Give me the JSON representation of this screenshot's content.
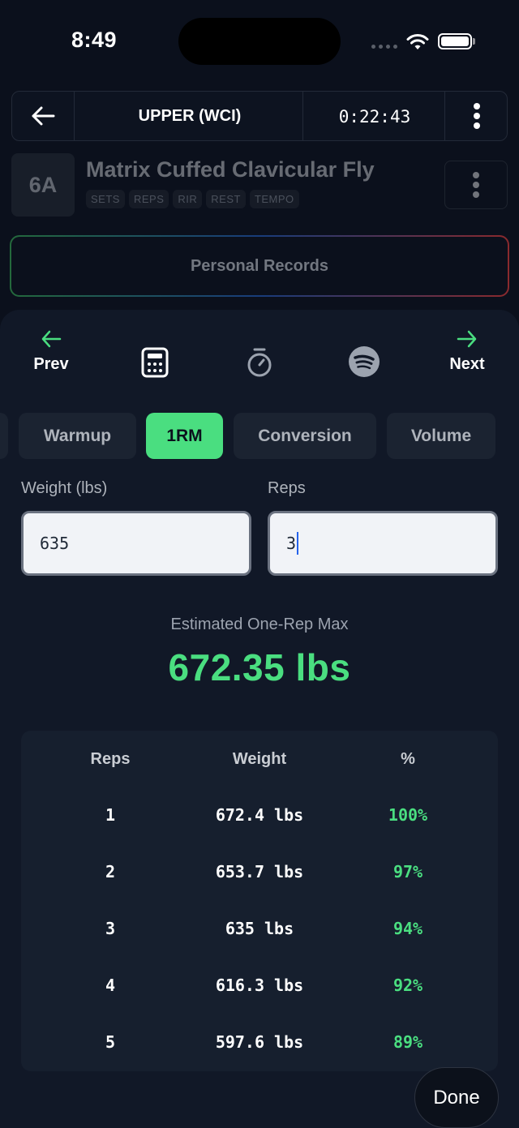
{
  "status_bar": {
    "time": "8:49"
  },
  "header": {
    "title": "UPPER (WCI)",
    "timer": "0:22:43"
  },
  "exercise": {
    "code": "6A",
    "name": "Matrix Cuffed Clavicular Fly",
    "tags": [
      "SETS",
      "REPS",
      "RIR",
      "REST",
      "TEMPO"
    ]
  },
  "personal_records": {
    "label": "Personal Records"
  },
  "nav": {
    "prev_label": "Prev",
    "next_label": "Next"
  },
  "tabs": [
    "Warmup",
    "1RM",
    "Conversion",
    "Volume"
  ],
  "active_tab": "1RM",
  "inputs": {
    "weight_label": "Weight (lbs)",
    "weight_value": "635",
    "reps_label": "Reps",
    "reps_value": "3"
  },
  "estimate": {
    "label": "Estimated One-Rep Max",
    "value": "672.35 lbs"
  },
  "table": {
    "headers": [
      "Reps",
      "Weight",
      "%"
    ],
    "rows": [
      {
        "reps": "1",
        "weight": "672.4 lbs",
        "pct": "100%"
      },
      {
        "reps": "2",
        "weight": "653.7 lbs",
        "pct": "97%"
      },
      {
        "reps": "3",
        "weight": "635 lbs",
        "pct": "94%"
      },
      {
        "reps": "4",
        "weight": "616.3 lbs",
        "pct": "92%"
      },
      {
        "reps": "5",
        "weight": "597.6 lbs",
        "pct": "89%"
      }
    ]
  },
  "done_label": "Done",
  "colors": {
    "accent": "#4ade80",
    "background": "#0b101c",
    "sheet": "#111827"
  }
}
